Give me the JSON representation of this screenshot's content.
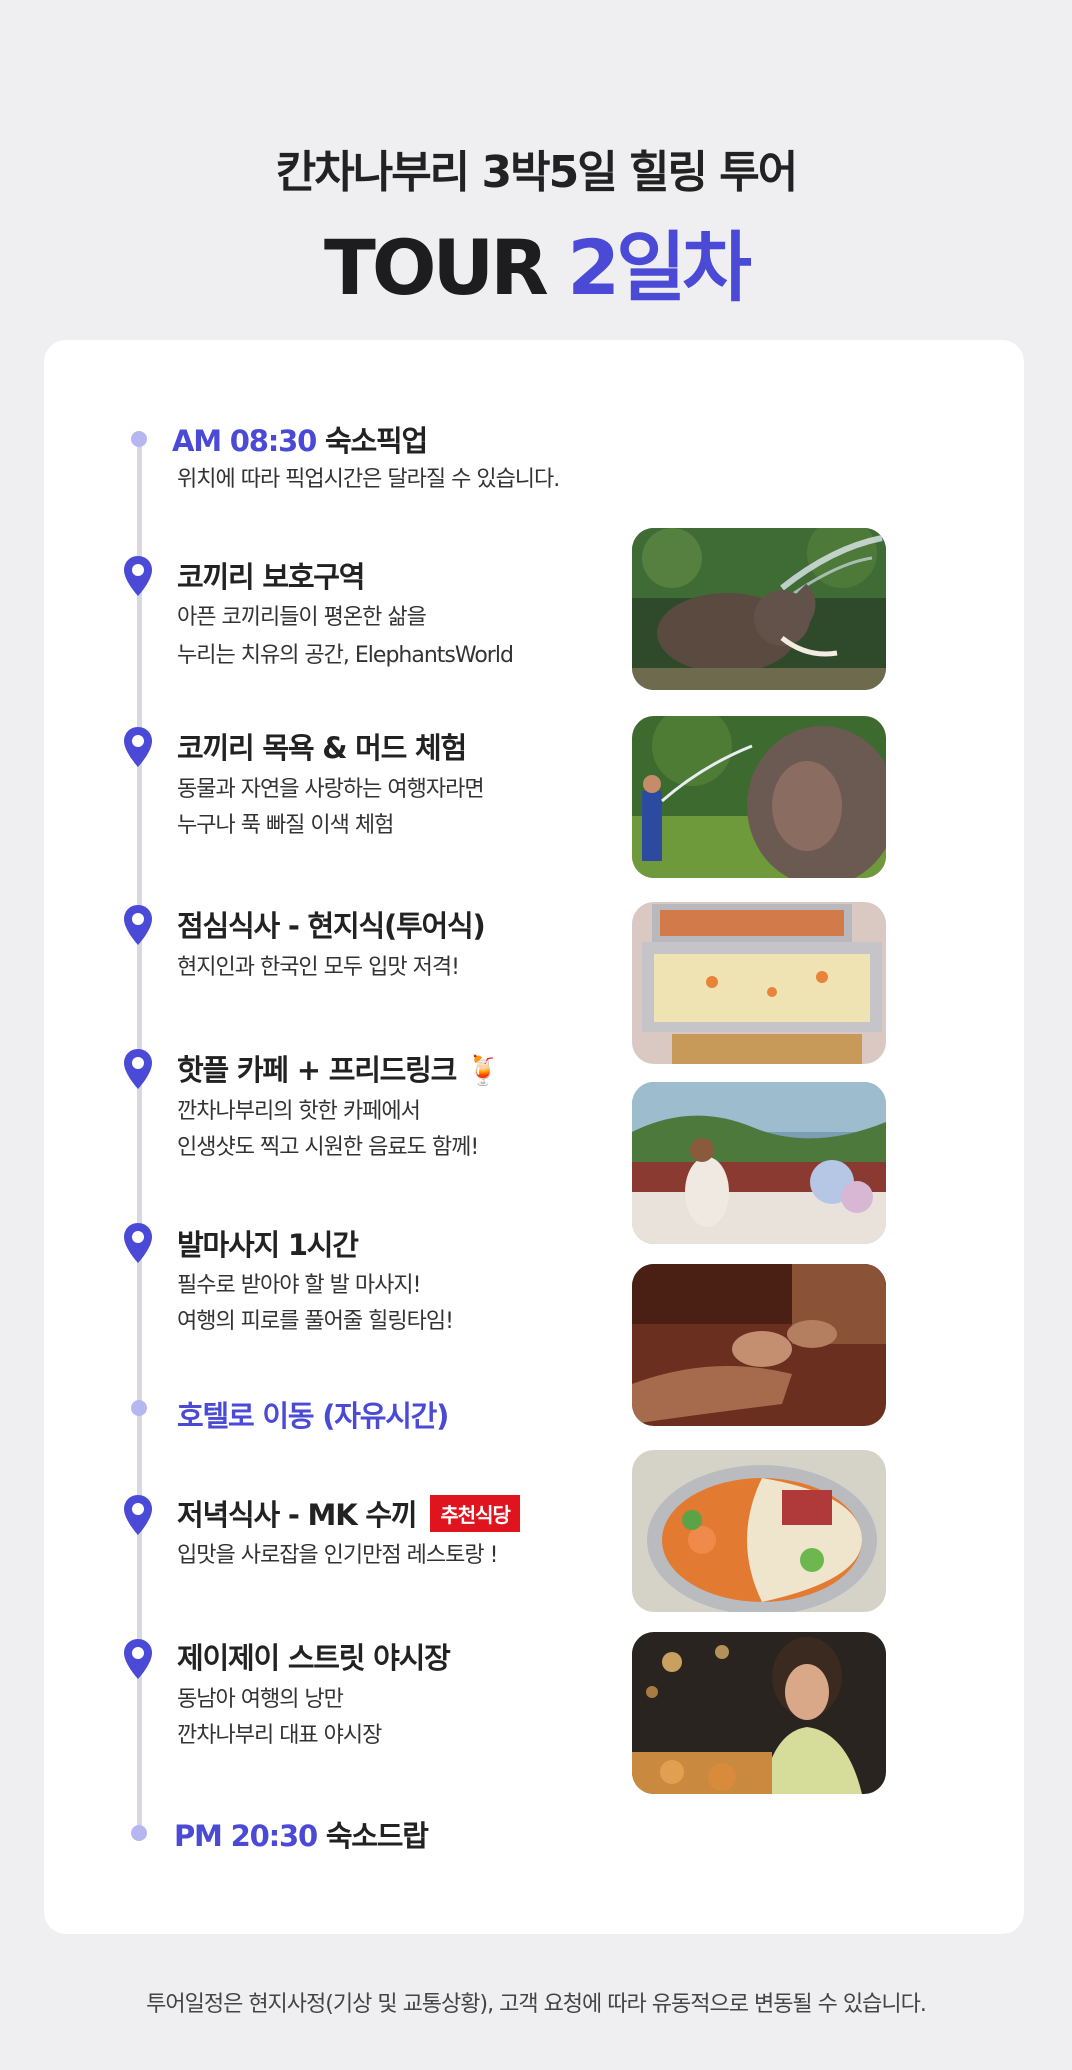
{
  "header": {
    "subtitle": "칸차나부리 3박5일 힐링 투어",
    "title_prefix": "TOUR",
    "title_accent": "2일차"
  },
  "timeline": {
    "pickup": {
      "time": "AM 08:30",
      "label": "숙소픽업",
      "desc": "위치에 따라 픽업시간은 달라질 수 있습니다."
    },
    "items": [
      {
        "title": "코끼리 보호구역",
        "desc1": "아픈 코끼리들이 평온한 삶을",
        "desc2": "누리는 치유의 공간, ElephantsWorld",
        "photo": "elephant-spraying-water"
      },
      {
        "title": "코끼리 목욕 & 머드 체험",
        "desc1": "동물과 자연을 사랑하는 여행자라면",
        "desc2": "누구나 푹 빠질 이색 체험",
        "photo": "elephant-bath"
      },
      {
        "title": "점심식사 - 현지식(투어식)",
        "desc1": "현지인과 한국인 모두 입맛 저격!",
        "desc2": "",
        "photo": "buffet-trays"
      },
      {
        "title": "핫플 카페 + 프리드링크",
        "emoji": "🍹",
        "desc1": "깐차나부리의 핫한 카페에서",
        "desc2": "인생샷도 찍고 시원한 음료도 함께!",
        "photo": "riverside-cafe"
      },
      {
        "title": "발마사지 1시간",
        "desc1": "필수로 받아야 할 발 마사지!",
        "desc2": "여행의 피로를 풀어줄 힐링타임!",
        "photo": "foot-massage"
      },
      {
        "title": "저녁식사 - MK 수끼",
        "badge": "추천식당",
        "desc1": "입맛을 사로잡을 인기만점 레스토랑 !",
        "desc2": "",
        "photo": "suki-hotpot"
      },
      {
        "title": "제이제이 스트릿 야시장",
        "desc1": "동남아 여행의 낭만",
        "desc2": "깐차나부리 대표 야시장",
        "photo": "night-market"
      }
    ],
    "hotel": "호텔로 이동 (자유시간)",
    "dropoff": {
      "time": "PM 20:30",
      "label": "숙소드랍"
    }
  },
  "footer": "투어일정은 현지사정(기상 및 교통상황), 고객 요청에 따라 유동적으로 변동될 수 있습니다.",
  "colors": {
    "accent": "#4a4ad6",
    "badge": "#e0141e",
    "dot": "#b6b7f0",
    "line": "#d8d8e2"
  }
}
